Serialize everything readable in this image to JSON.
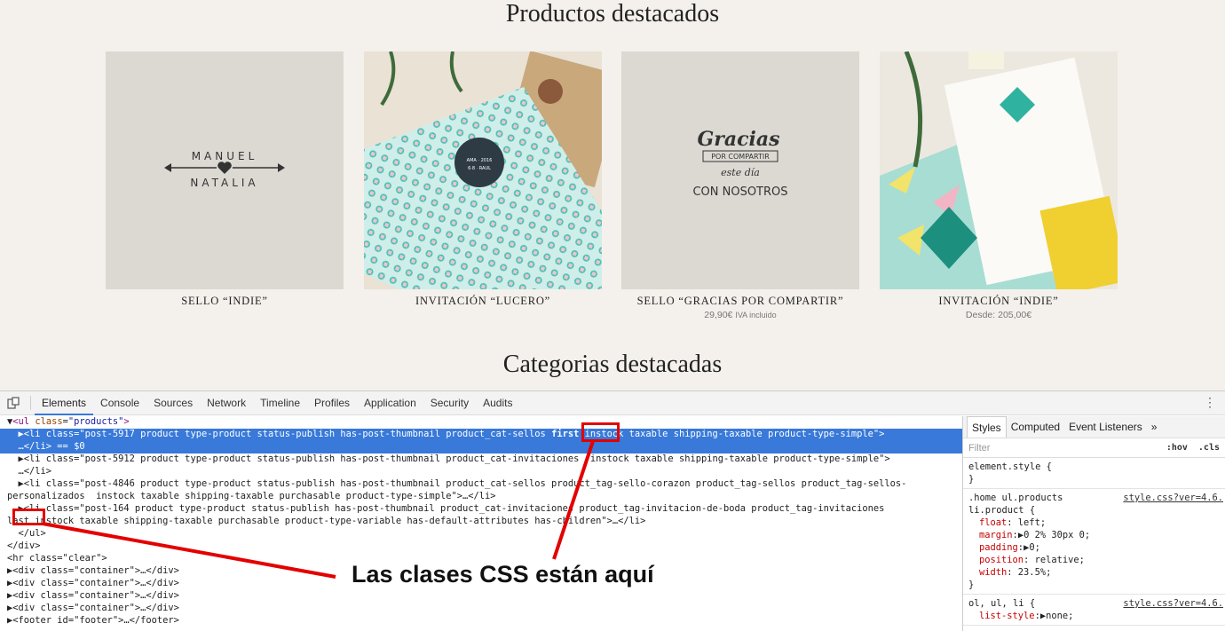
{
  "sections": {
    "featured_products_title": "Productos destacados",
    "featured_categories_title": "Categorias destacadas"
  },
  "products": [
    {
      "name": "SELLO “INDIE”",
      "price": "",
      "tax": ""
    },
    {
      "name": "INVITACIÓN “LUCERO”",
      "price": "",
      "tax": ""
    },
    {
      "name": "SELLO “GRACIAS POR COMPARTIR”",
      "price": "29,90€",
      "tax": "IVA incluido"
    },
    {
      "name": "INVITACIÓN “INDIE”",
      "price": "Desde: 205,00€",
      "tax": ""
    }
  ],
  "product_images": {
    "indie_stamp": {
      "line1": "MANUEL",
      "line2": "NATALIA"
    },
    "gracias_stamp": {
      "line1": "Gracias",
      "line2": "POR COMPARTIR",
      "line3": "este día",
      "line4": "CON NOSOTROS"
    }
  },
  "devtools": {
    "tabs": [
      "Elements",
      "Console",
      "Sources",
      "Network",
      "Timeline",
      "Profiles",
      "Application",
      "Security",
      "Audits"
    ],
    "active_tab": "Elements",
    "more_icon": "kebab-menu-icon",
    "styles_tabs": [
      "Styles",
      "Computed",
      "Event Listeners",
      "»"
    ],
    "filter_placeholder": "Filter",
    "hov": ":hov",
    "cls": ".cls",
    "dom_lines": {
      "l1_tag": "<ul",
      "l1_attr": "class",
      "l1_val": "\"products\"",
      "l2_pre": "▶<li class=\"post-5917 product type-product status-publish has-post-thumbnail product_cat-sellos ",
      "l2_hl": "first",
      "l2_post": " instock taxable shipping-taxable product-type-simple\">",
      "l3": "  …</li> == $0",
      "l4": "  ▶<li class=\"post-5912 product type-product status-publish has-post-thumbnail product_cat-invitaciones  instock taxable shipping-taxable product-type-simple\">",
      "l5": "  …</li>",
      "l6": "  ▶<li class=\"post-4846 product type-product status-publish has-post-thumbnail product_cat-sellos product_tag-sello-corazon product_tag-sellos product_tag-sellos-",
      "l7": "personalizados  instock taxable shipping-taxable purchasable product-type-simple\">…</li>",
      "l8": "  ▶<li class=\"post-164 product type-product status-publish has-post-thumbnail product_cat-invitaciones product_tag-invitacion-de-boda product_tag-invitaciones",
      "l9_hl": "last",
      "l9_post": " instock taxable shipping-taxable purchasable product-type-variable has-default-attributes has-children\">…</li>",
      "l10": "  </ul>",
      "l11": "</div>",
      "l12": "<hr class=\"clear\">",
      "l13": "▶<div class=\"container\">…</div>",
      "l14": "▶<div class=\"container\">…</div>",
      "l15": "▶<div class=\"container\">…</div>",
      "l16": "▶<div class=\"container\">…</div>",
      "l17": "▶<footer id=\"footer\">…</footer>"
    },
    "styles": {
      "r1_selector": "element.style {",
      "r1_close": "}",
      "r2_selector1": ".home ul.products",
      "r2_selector2": "li.product {",
      "r2_src": "style.css?ver=4.6.",
      "r2_props": [
        {
          "name": "float",
          "value": "left;"
        },
        {
          "name": "margin",
          "value": "▶0 2% 30px 0;"
        },
        {
          "name": "padding",
          "value": "▶0;"
        },
        {
          "name": "position",
          "value": "relative;"
        },
        {
          "name": "width",
          "value": "23.5%;"
        }
      ],
      "r2_close": "}",
      "r3_selector": "ol, ul, li {",
      "r3_src": "style.css?ver=4.6.",
      "r3_props": [
        {
          "name": "list-style",
          "value": "▶none;"
        }
      ]
    }
  },
  "annotation": {
    "text": "Las clases CSS están aquí",
    "color": "#e30000"
  }
}
